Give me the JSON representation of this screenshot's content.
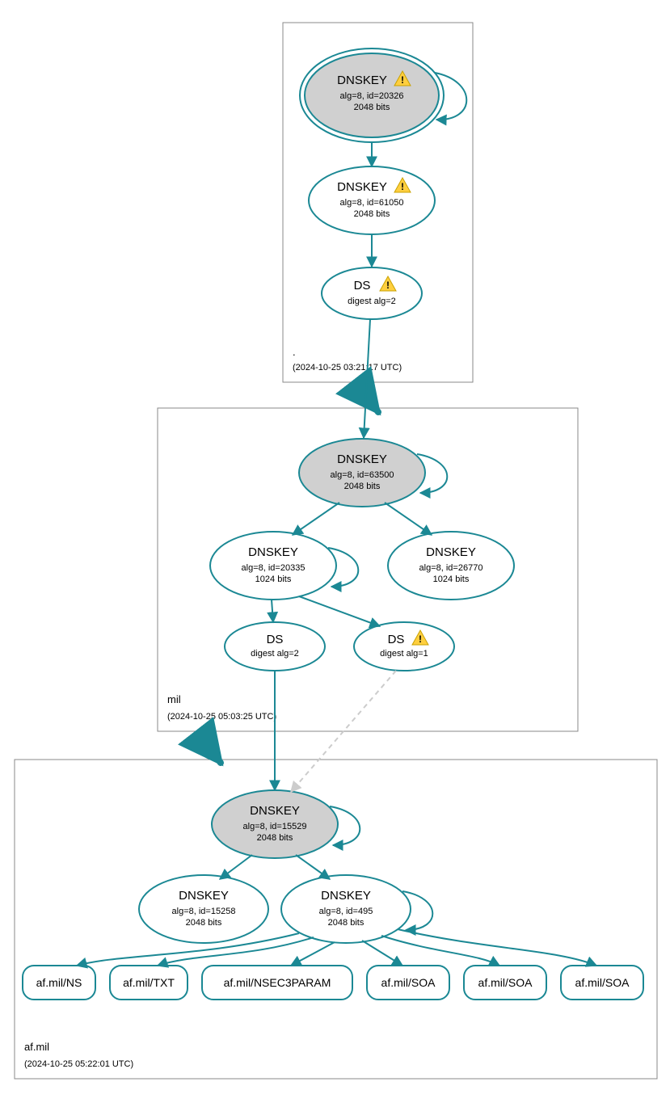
{
  "colors": {
    "teal": "#1b8894",
    "grey": "#cccccc",
    "lightgrey": "#dddddd",
    "nodeFill": "#d0d0d0"
  },
  "zones": {
    "root": {
      "label": ".",
      "timestamp": "(2024-10-25 03:21:17 UTC)"
    },
    "mil": {
      "label": "mil",
      "timestamp": "(2024-10-25 05:03:25 UTC)"
    },
    "afmil": {
      "label": "af.mil",
      "timestamp": "(2024-10-25 05:22:01 UTC)"
    }
  },
  "nodes": {
    "root_ksk": {
      "line1": "DNSKEY",
      "line2": "alg=8, id=20326",
      "line3": "2048 bits",
      "warn": true
    },
    "root_zsk": {
      "line1": "DNSKEY",
      "line2": "alg=8, id=61050",
      "line3": "2048 bits",
      "warn": true
    },
    "root_ds": {
      "line1": "DS",
      "line2": "digest alg=2",
      "warn": true
    },
    "mil_ksk": {
      "line1": "DNSKEY",
      "line2": "alg=8, id=63500",
      "line3": "2048 bits"
    },
    "mil_zsk1": {
      "line1": "DNSKEY",
      "line2": "alg=8, id=20335",
      "line3": "1024 bits"
    },
    "mil_zsk2": {
      "line1": "DNSKEY",
      "line2": "alg=8, id=26770",
      "line3": "1024 bits"
    },
    "mil_ds1": {
      "line1": "DS",
      "line2": "digest alg=2"
    },
    "mil_ds2": {
      "line1": "DS",
      "line2": "digest alg=1",
      "warn": true
    },
    "af_ksk": {
      "line1": "DNSKEY",
      "line2": "alg=8, id=15529",
      "line3": "2048 bits"
    },
    "af_zsk1": {
      "line1": "DNSKEY",
      "line2": "alg=8, id=15258",
      "line3": "2048 bits"
    },
    "af_zsk2": {
      "line1": "DNSKEY",
      "line2": "alg=8, id=495",
      "line3": "2048 bits"
    }
  },
  "rrsets": {
    "r1": "af.mil/NS",
    "r2": "af.mil/TXT",
    "r3": "af.mil/NSEC3PARAM",
    "r4": "af.mil/SOA",
    "r5": "af.mil/SOA",
    "r6": "af.mil/SOA"
  }
}
